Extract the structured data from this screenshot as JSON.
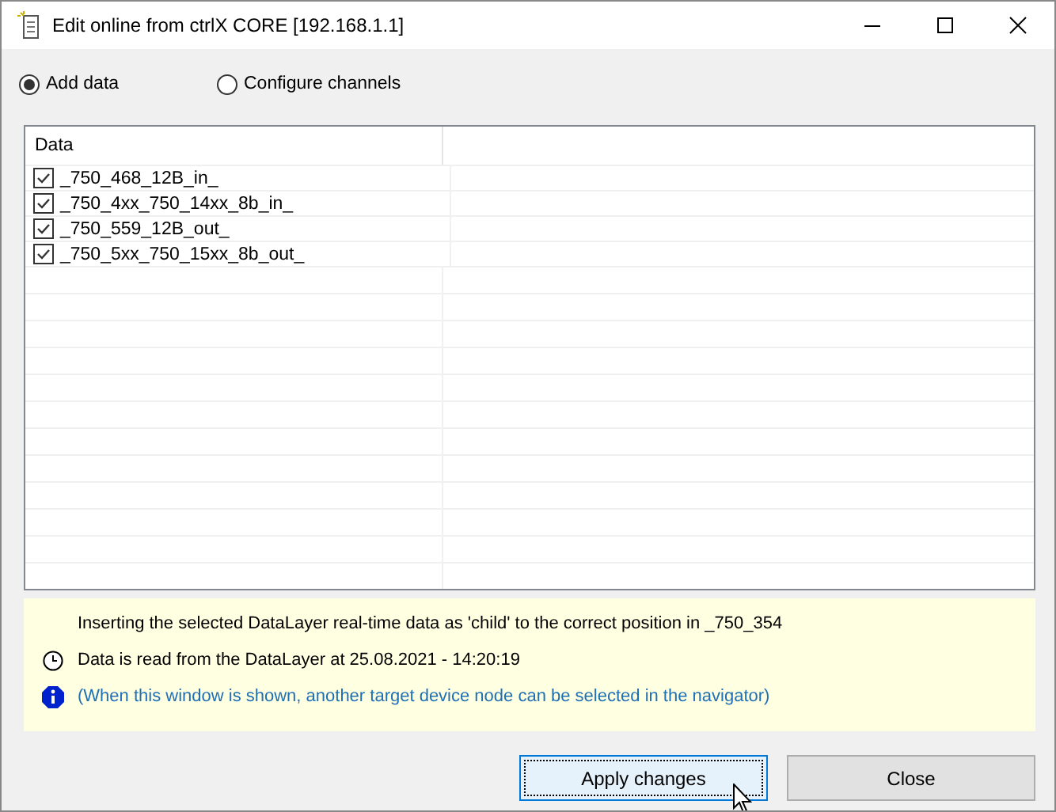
{
  "window": {
    "title": "Edit online from ctrlX CORE [192.168.1.1]"
  },
  "modes": [
    {
      "label": "Add data",
      "selected": true
    },
    {
      "label": "Configure channels",
      "selected": false
    }
  ],
  "table": {
    "columns": [
      "Data"
    ],
    "rows": [
      {
        "label": "_750_468_12B_in_",
        "checked": true
      },
      {
        "label": "_750_4xx_750_14xx_8b_in_",
        "checked": true
      },
      {
        "label": "_750_559_12B_out_",
        "checked": true
      },
      {
        "label": "_750_5xx_750_15xx_8b_out_",
        "checked": true
      }
    ]
  },
  "info": [
    {
      "kind": "plain",
      "text": "Inserting the selected DataLayer real-time data as 'child' to the correct position in _750_354"
    },
    {
      "kind": "clock",
      "text": "Data is read from the DataLayer at  25.08.2021 - 14:20:19"
    },
    {
      "kind": "info",
      "text": "(When this window is shown, another target device node can be selected in the navigator)"
    }
  ],
  "buttons": [
    {
      "label": "Apply changes",
      "kind": "primary"
    },
    {
      "label": "Close",
      "kind": "normal"
    }
  ]
}
